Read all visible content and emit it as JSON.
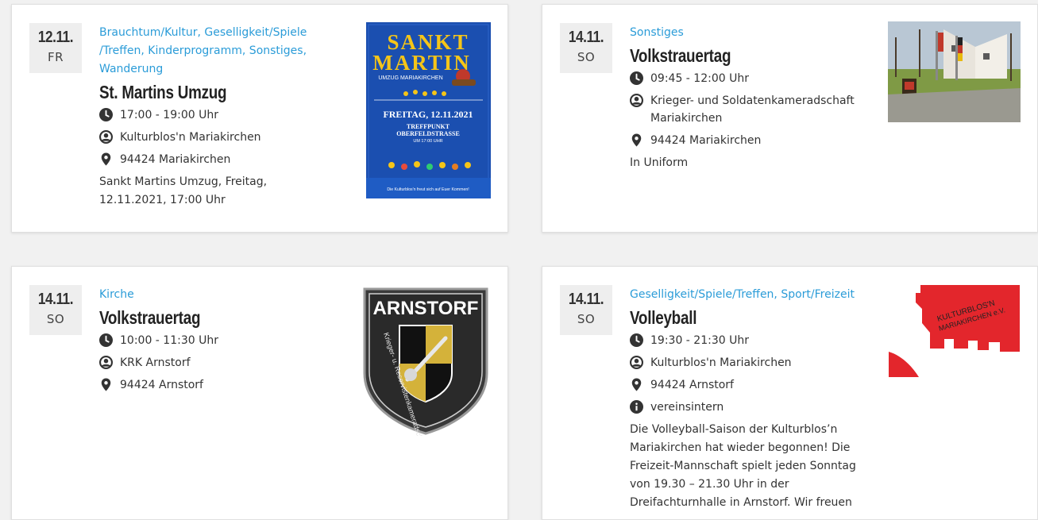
{
  "events": [
    {
      "date": "12.11.",
      "weekday": "FR",
      "categories": "Brauchtum/Kultur, Geselligkeit/Spiele /Treffen, Kinderprogramm, Sonstiges, Wanderung",
      "title": "St. Martins Umzug",
      "time": "17:00 - 19:00 Uhr",
      "organizer": "Kulturblos'n Mariakirchen",
      "location": "94424 Mariakirchen",
      "description": "Sankt Martins Umzug, Freitag, 12.11.2021, 17:00 Uhr",
      "image": {
        "line1": "SANKT",
        "line2": "MARTIN",
        "sub": "UMZUG MARIAKIRCHEN",
        "date_text": "FREITAG, 12.11.2021",
        "meet1": "TREFFPUNKT",
        "meet2": "OBERFELDSTRASSE",
        "meet3": "UM 17:00 UHR",
        "footer": "Die Kulturblos'n freut sich auf Euer Kommen!"
      }
    },
    {
      "date": "14.11.",
      "weekday": "SO",
      "categories": "Sonstiges",
      "title": "Volkstrauertag",
      "time": "09:45 - 12:00 Uhr",
      "organizer": "Krieger- und Soldatenkameradschaft Mariakirchen",
      "location": "94424 Mariakirchen",
      "description": "In Uniform"
    },
    {
      "date": "14.11.",
      "weekday": "SO",
      "categories": "Kirche",
      "title": "Volkstrauertag",
      "time": "10:00 - 11:30 Uhr",
      "organizer": "KRK Arnstorf",
      "location": "94424 Arnstorf",
      "image": {
        "top": "ARNSTORF",
        "ring": "Krieger- u. Reservistenkameradschaft"
      }
    },
    {
      "date": "14.11.",
      "weekday": "SO",
      "categories": "Geselligkeit/Spiele/Treffen, Sport/Freizeit",
      "title": "Volleyball",
      "time": "19:30 - 21:30 Uhr",
      "organizer": "Kulturblos'n Mariakirchen",
      "location": "94424 Arnstorf",
      "info": "vereinsintern",
      "description": "Die Volleyball-Saison der Kulturblos’n Mariakirchen hat wieder begonnen! Die Freizeit-Mannschaft spielt jeden Sonntag von 19.30 – 21.30 Uhr in der Dreifachturnhalle in Arnstorf. Wir freuen",
      "image": {
        "logo1": "KULTURBLOS'N",
        "logo2": "MARIAKIRCHEN e.V."
      }
    }
  ],
  "colors": {
    "category_link": "#2b9cd8",
    "logo_red": "#e3262c",
    "poster_blue": "#1b4fb0",
    "poster_yellow": "#f5c518"
  },
  "icons": [
    "clock-icon",
    "user-icon",
    "map-marker-icon",
    "info-icon"
  ]
}
